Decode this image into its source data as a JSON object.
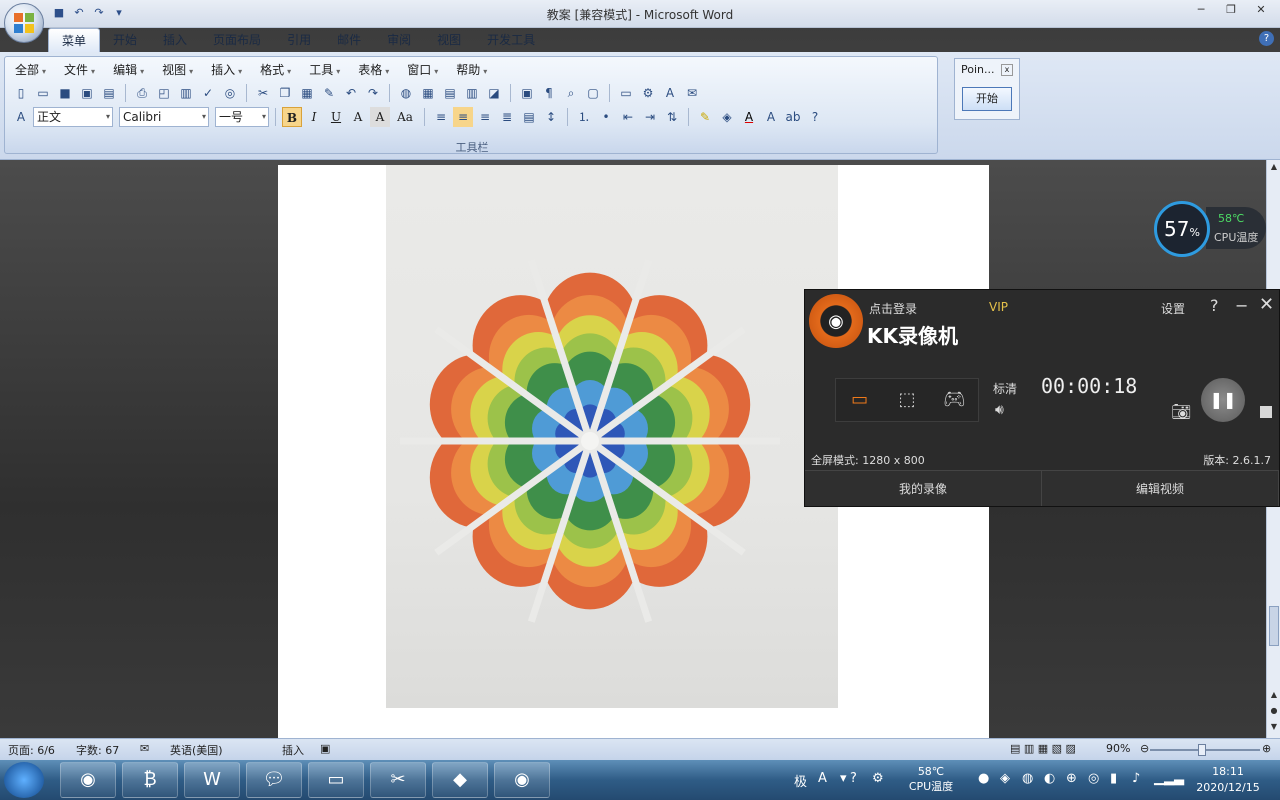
{
  "window": {
    "title": "教案 [兼容模式] - Microsoft Word"
  },
  "ribbon_tabs": [
    "菜单",
    "开始",
    "插入",
    "页面布局",
    "引用",
    "邮件",
    "审阅",
    "视图",
    "开发工具"
  ],
  "menu_bar": [
    "全部",
    "文件",
    "编辑",
    "视图",
    "插入",
    "格式",
    "工具",
    "表格",
    "窗口",
    "帮助"
  ],
  "toolbar": {
    "style_value": "正文",
    "font_value": "Calibri",
    "size_value": "一号",
    "group_label": "工具栏"
  },
  "pointer_dialog": {
    "title": "Poin...",
    "start_button": "开始"
  },
  "cpu_widget": {
    "usage": "57",
    "usage_unit": "%",
    "temp": "58℃",
    "label": "CPU温度"
  },
  "kk": {
    "login": "点击登录",
    "vip": "VIP",
    "name": "KK录像机",
    "settings": "设置",
    "help": "?",
    "quality": "标清",
    "timer": "00:00:18",
    "mode_text": "全屏模式: 1280 x 800",
    "version": "版本: 2.6.1.7",
    "my_recordings": "我的录像",
    "edit_video": "编辑视频"
  },
  "status": {
    "page": "页面: 6/6",
    "words": "字数: 67",
    "language": "英语(美国)",
    "insert": "插入",
    "zoom": "90%"
  },
  "tray": {
    "ime": "极",
    "temp": "58℃",
    "temp_label": "CPU温度",
    "time": "18:11",
    "date": "2020/12/15"
  },
  "colors": {
    "petal_orange": "#e0683a",
    "petal_yellow": "#d9d34a",
    "petal_green": "#3f8f4a",
    "petal_blue": "#2e57b8",
    "kk_accent": "#f07a1a"
  }
}
